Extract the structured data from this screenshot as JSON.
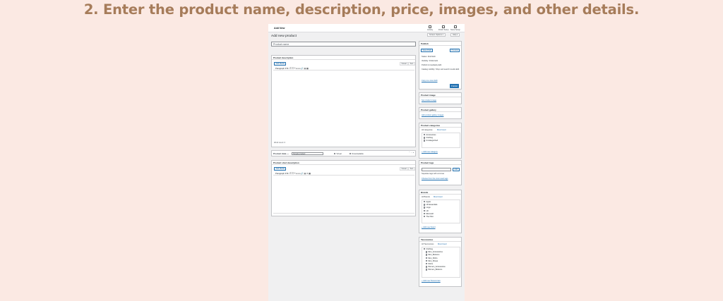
{
  "heading": "2.   Enter the product name, description, price, images, and other details.",
  "topbar": {
    "title": "Add New",
    "items": [
      {
        "label": "Activity",
        "icon": "activity-icon"
      },
      {
        "label": "Finish Setup",
        "icon": "finish-setup-icon"
      },
      {
        "label": "Store Setup",
        "icon": "store-setup-icon"
      }
    ],
    "screen_options": "Screen Options ▾",
    "help": "Help ▾"
  },
  "page_title": "Add new product",
  "product_name_placeholder": "Product name",
  "description": {
    "title": "Product description",
    "add_media": "Add Media",
    "tab_visual": "Visual",
    "tab_text": "Text",
    "toolbar": "Paragraph ▾   B   I   ☰   ☰   ❝   ≡   ≡   ≡   🔗   ▤   ▦",
    "word_count": "Word count: 0"
  },
  "product_data": {
    "label": "Product data —",
    "type": "Simple product",
    "virtual": "Virtual",
    "downloadable": "Downloadable"
  },
  "short_description": {
    "title": "Product short description",
    "add_media": "Add Media",
    "tab_visual": "Visual",
    "tab_text": "Text",
    "toolbar": "Paragraph ▾   B   I   ☰   ☰   ❝   ≡   ≡   ≡   🔗   ▤   ✕   ▦"
  },
  "publish": {
    "title": "Publish",
    "save_draft": "Save Draft",
    "preview": "Preview",
    "status": "Status: Draft Edit",
    "visibility": "Visibility: Public Edit",
    "publish_time": "Publish immediately Edit",
    "catalog": "Catalog visibility: Shop and search results Edit",
    "copy_draft": "Copy to a new draft",
    "publish_button": "Publish"
  },
  "product_image": {
    "title": "Product image",
    "link": "Set product image"
  },
  "product_gallery": {
    "title": "Product gallery",
    "link": "Add product gallery images"
  },
  "categories": {
    "title": "Product categories",
    "tab_all": "All categories",
    "tab_used": "Most Used",
    "items": [
      "Accessories",
      "Clothing",
      "Uncategorized"
    ],
    "add_link": "+ Add new category"
  },
  "tags": {
    "title": "Product tags",
    "add_button": "Add",
    "hint": "Separate tags with commas",
    "choose_link": "Choose from the most used tags"
  },
  "brands": {
    "title": "Brands",
    "tab_all": "All Brands",
    "tab_used": "Most Used",
    "items": [
      "Apple",
      "Lift Essentials",
      "Lingo",
      "Lift",
      "Microsoft",
      "The Pilot"
    ],
    "add_link": "+ Add new brand"
  },
  "taxonomies": {
    "title": "Taxonomies",
    "tab_all": "All Taxonomies",
    "tab_used": "Most Used",
    "items": [
      "Clothing",
      "Men_Accessories",
      "Men_Bottoms",
      "Men_Shirts",
      "Men_Shoes",
      "Shirts",
      "Women_Accessories",
      "Women_Bottoms"
    ],
    "add_link": "+ Add new Taxonomies"
  },
  "colors": {
    "heading": "#a67c5a",
    "background": "#fbe9e3",
    "accent": "#2271b1"
  }
}
